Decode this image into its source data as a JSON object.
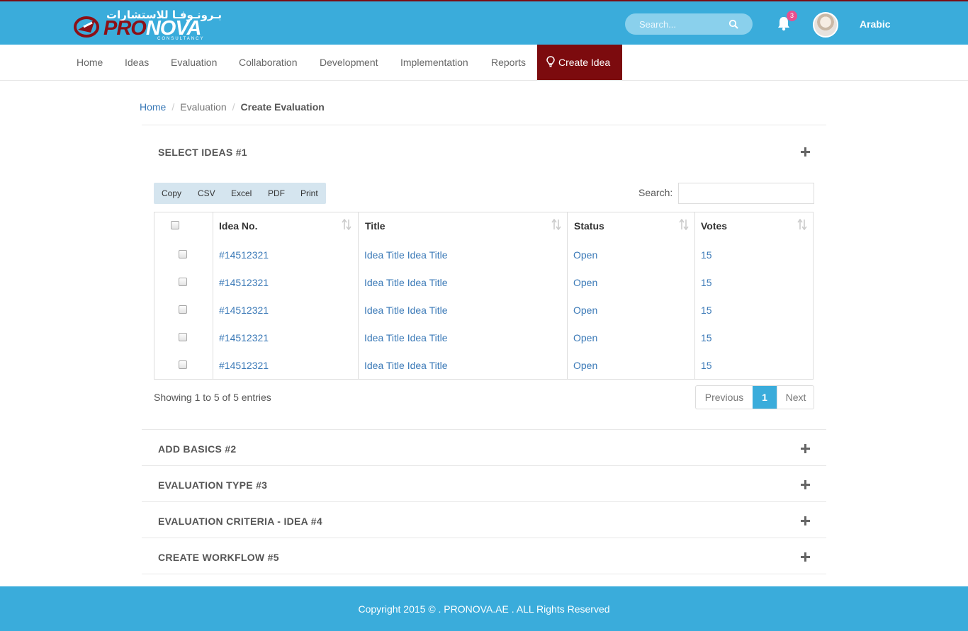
{
  "header": {
    "logo_arabic": "بـرونـوفـا للاستشارات",
    "logo_pro": "PRO",
    "logo_nova": "NOVA",
    "logo_sub": "CONSULTANCY",
    "search_placeholder": "Search...",
    "notification_count": "3",
    "language_label": "Arabic",
    "accent_color": "#3aacdb",
    "brand_color": "#7c0b0e"
  },
  "nav": {
    "items": [
      "Home",
      "Ideas",
      "Evaluation",
      "Collaboration",
      "Development",
      "Implementation",
      "Reports"
    ],
    "create_label": "Create Idea"
  },
  "breadcrumb": {
    "home": "Home",
    "evaluation": "Evaluation",
    "current": "Create Evaluation"
  },
  "sections": {
    "s1": "SELECT IDEAS #1",
    "s2": "ADD BASICS #2",
    "s3": "EVALUATION TYPE #3",
    "s4": "EVALUATION CRITERIA - IDEA #4",
    "s5": "CREATE WORKFLOW #5"
  },
  "table_tools": {
    "buttons": [
      "Copy",
      "CSV",
      "Excel",
      "PDF",
      "Print"
    ],
    "search_label": "Search:"
  },
  "table": {
    "headers": [
      "Idea No.",
      "Title",
      "Status",
      "Votes"
    ],
    "rows": [
      {
        "no": "#14512321",
        "title": "Idea Title Idea Title",
        "status": "Open",
        "votes": "15"
      },
      {
        "no": "#14512321",
        "title": "Idea Title Idea Title",
        "status": "Open",
        "votes": "15"
      },
      {
        "no": "#14512321",
        "title": "Idea Title Idea Title",
        "status": "Open",
        "votes": "15"
      },
      {
        "no": "#14512321",
        "title": "Idea Title Idea Title",
        "status": "Open",
        "votes": "15"
      },
      {
        "no": "#14512321",
        "title": "Idea Title Idea Title",
        "status": "Open",
        "votes": "15"
      }
    ]
  },
  "pagination": {
    "info": "Showing 1 to 5 of 5 entries",
    "previous": "Previous",
    "current": "1",
    "next": "Next"
  },
  "footer": {
    "text": "Copyright 2015 © . PRONOVA.AE . ALL Rights Reserved"
  }
}
